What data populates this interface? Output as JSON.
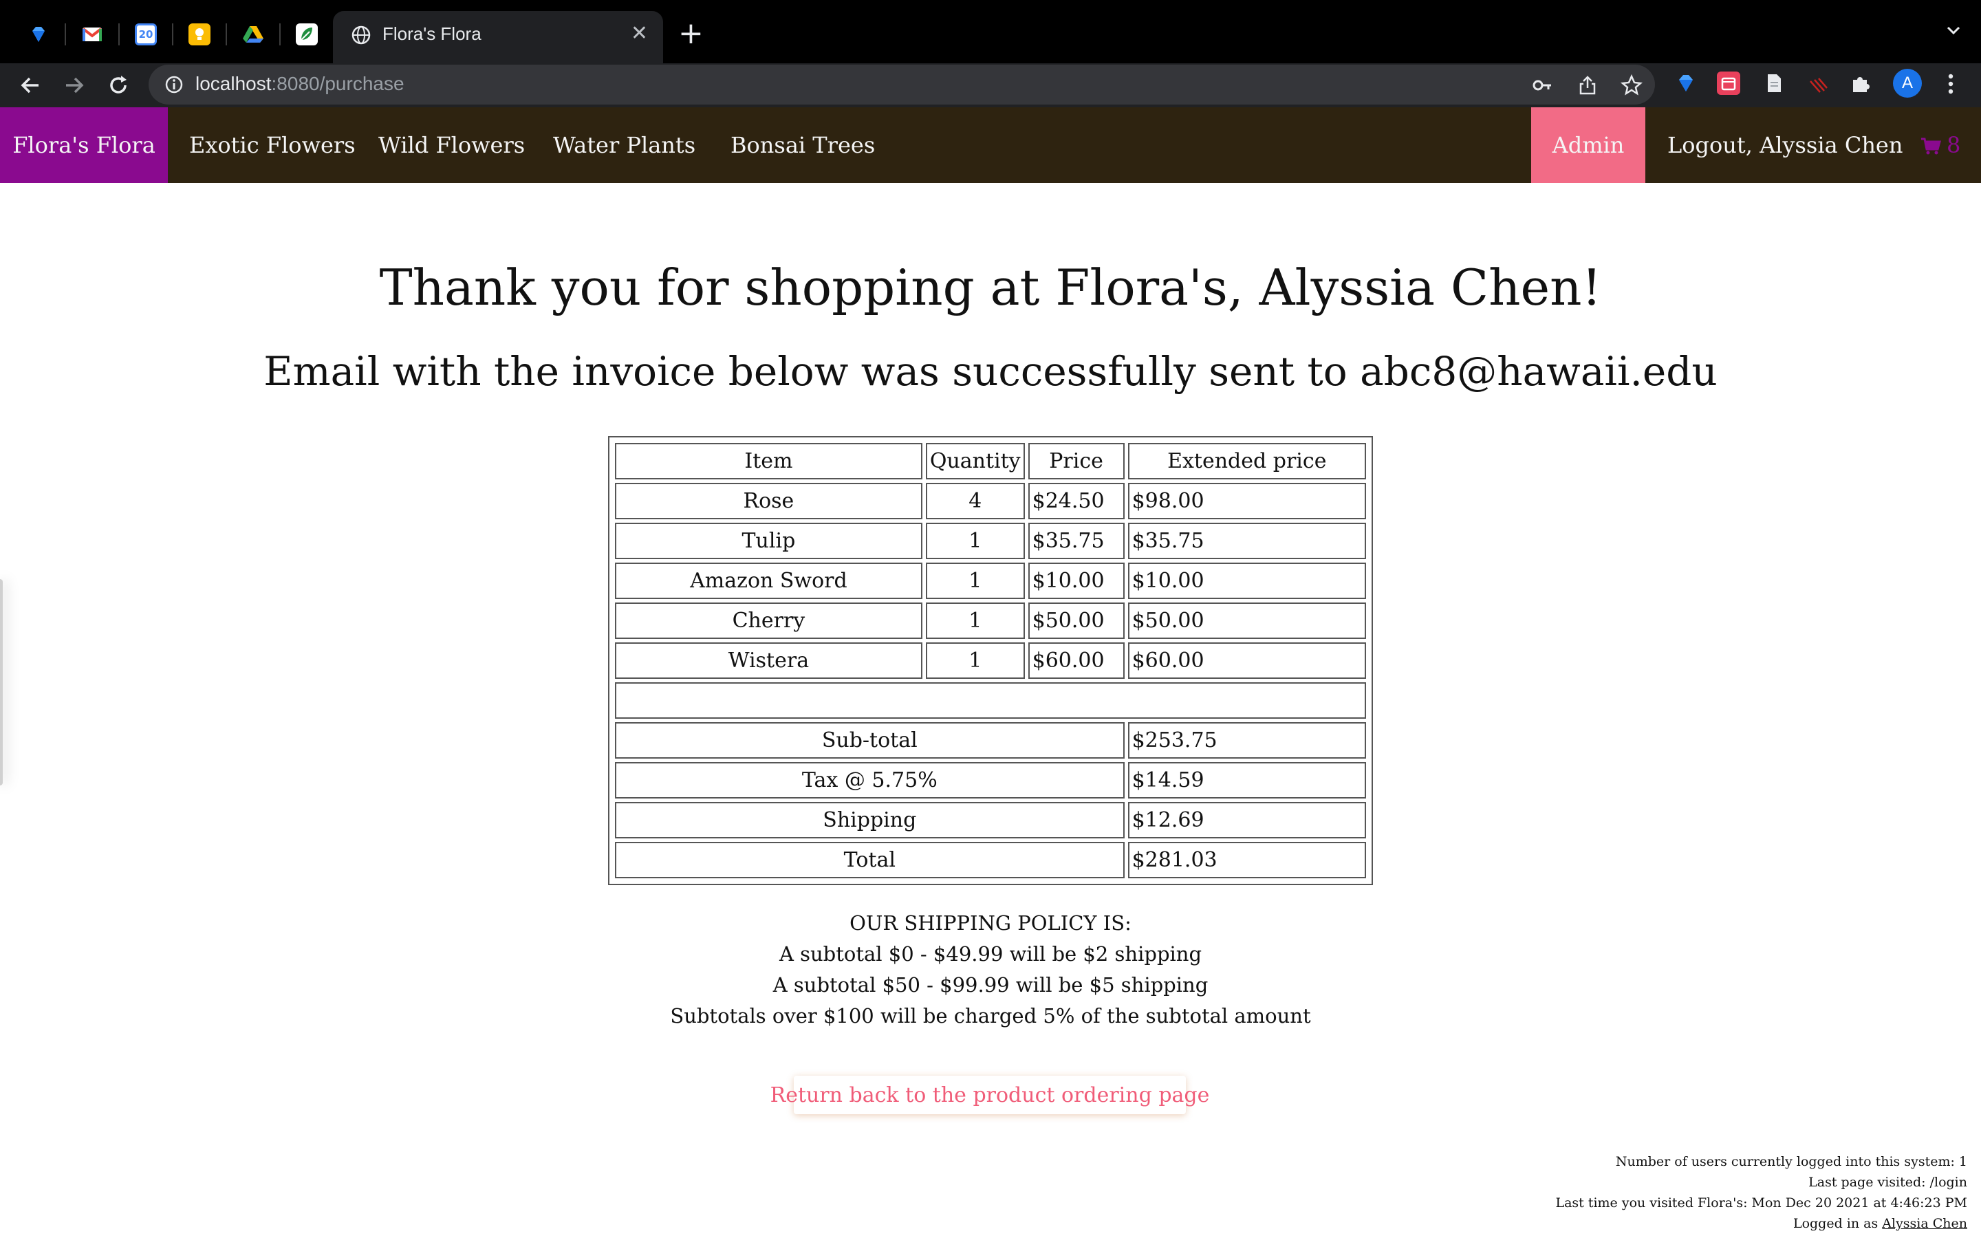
{
  "browser": {
    "active_tab_title": "Flora's Flora",
    "url_host": "localhost",
    "url_path": ":8080/purchase",
    "profile_initial": "A",
    "pinned_tabs": [
      {
        "name": "sapphire-icon",
        "color": "#1a73e8"
      },
      {
        "name": "gmail-icon",
        "color": "#ea4335",
        "glyph": "M"
      },
      {
        "name": "calendar-icon",
        "color": "#4285f4",
        "glyph": "20"
      },
      {
        "name": "keep-icon",
        "color": "#fbbc04"
      },
      {
        "name": "drive-icon",
        "color": "#34a853"
      },
      {
        "name": "leaf-app-icon",
        "color": "#1e8e3e"
      }
    ]
  },
  "nav": {
    "brand": "Flora's Flora",
    "links": [
      "Exotic Flowers",
      "Wild Flowers",
      "Water Plants",
      "Bonsai Trees"
    ],
    "admin": "Admin",
    "logout": "Logout, Alyssia Chen",
    "cart_count": "8",
    "colors": {
      "bar": "#2e2310",
      "brand": "#8a0a8f",
      "admin": "#f26b86"
    }
  },
  "main": {
    "thank_you": "Thank you for shopping at Flora's, Alyssia Chen!",
    "email_notice": "Email with the invoice below was successfully sent to abc8@hawaii.edu"
  },
  "invoice": {
    "headers": [
      "Item",
      "Quantity",
      "Price",
      "Extended price"
    ],
    "rows": [
      {
        "item": "Rose",
        "quantity": "4",
        "price": "$24.50",
        "extended": "$98.00"
      },
      {
        "item": "Tulip",
        "quantity": "1",
        "price": "$35.75",
        "extended": "$35.75"
      },
      {
        "item": "Amazon Sword",
        "quantity": "1",
        "price": "$10.00",
        "extended": "$10.00"
      },
      {
        "item": "Cherry",
        "quantity": "1",
        "price": "$50.00",
        "extended": "$50.00"
      },
      {
        "item": "Wistera",
        "quantity": "1",
        "price": "$60.00",
        "extended": "$60.00"
      }
    ],
    "subtotal_label": "Sub-total",
    "subtotal": "$253.75",
    "tax_label": "Tax @ 5.75%",
    "tax": "$14.59",
    "shipping_label": "Shipping",
    "shipping": "$12.69",
    "total_label": "Total",
    "total": "$281.03"
  },
  "policy": {
    "title": "OUR SHIPPING POLICY IS:",
    "lines": [
      "A subtotal $0 - $49.99 will be $2 shipping",
      "A subtotal $50 - $99.99 will be $5 shipping",
      "Subtotals over $100 will be charged 5% of the subtotal amount"
    ]
  },
  "return_button": "Return back to the product ordering page",
  "footer": {
    "users_logged_in": "Number of users currently logged into this system: 1",
    "last_page": "Last page visited: /login",
    "last_visit": "Last time you visited Flora's: Mon Dec 20 2021 at 4:46:23 PM",
    "logged_in_prefix": "Logged in as ",
    "logged_in_user": "Alyssia Chen"
  }
}
